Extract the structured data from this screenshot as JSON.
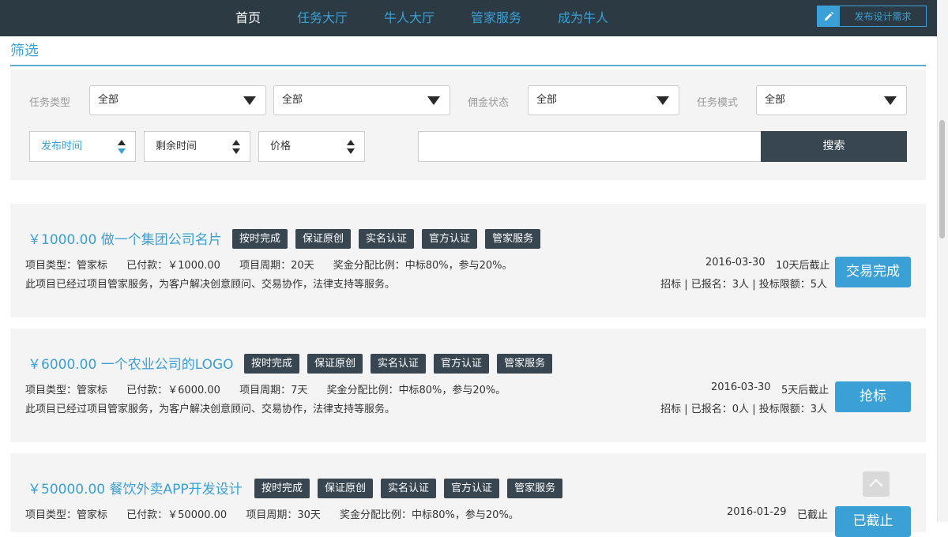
{
  "nav": {
    "items": [
      {
        "label": "首页",
        "active": true
      },
      {
        "label": "任务大厅",
        "active": false
      },
      {
        "label": "牛人大厅",
        "active": false
      },
      {
        "label": "管家服务",
        "active": false
      },
      {
        "label": "成为牛人",
        "active": false
      }
    ],
    "publish_label": "发布设计需求",
    "publish_icon": "pencil-icon"
  },
  "filter": {
    "title": "筛选",
    "task_type_label": "任务类型",
    "task_type_value": "全部",
    "task_subtype_value": "全部",
    "commission_label": "佣金状态",
    "commission_value": "全部",
    "mode_label": "任务模式",
    "mode_value": "全部",
    "sort_publish": "发布时间",
    "sort_remaining": "剩余时间",
    "sort_price": "价格",
    "search_value": "",
    "search_button": "搜索"
  },
  "tasks": [
    {
      "price_title": "￥1000.00 做一个集团公司名片",
      "tags": [
        "按时完成",
        "保证原创",
        "实名认证",
        "官方认证",
        "管家服务"
      ],
      "type": "项目类型：管家标",
      "paid": "已付款：￥1000.00",
      "period": "项目周期：20天",
      "ratio": "奖金分配比例：中标80%，参与20%。",
      "desc": "此项目已经过项目管家服务，为客户解决创意顾问、交易协作，法律支持等服务。",
      "date": "2016-03-30",
      "deadline": "10天后截止",
      "stats": "招标 | 已报名：3人 | 投标限额：5人",
      "action": "交易完成"
    },
    {
      "price_title": "￥6000.00 一个农业公司的LOGO",
      "tags": [
        "按时完成",
        "保证原创",
        "实名认证",
        "官方认证",
        "管家服务"
      ],
      "type": "项目类型：管家标",
      "paid": "已付款：￥6000.00",
      "period": "项目周期：7天",
      "ratio": "奖金分配比例：中标80%，参与20%。",
      "desc": "此项目已经过项目管家服务，为客户解决创意顾问、交易协作，法律支持等服务。",
      "date": "2016-03-30",
      "deadline": "5天后截止",
      "stats": "招标 | 已报名：0人 | 投标限额：3人",
      "action": "抢标"
    },
    {
      "price_title": "￥50000.00 餐饮外卖APP开发设计",
      "tags": [
        "按时完成",
        "保证原创",
        "实名认证",
        "官方认证",
        "管家服务"
      ],
      "type": "项目类型：管家标",
      "paid": "已付款：￥50000.00",
      "period": "项目周期：30天",
      "ratio": "奖金分配比例：中标80%，参与20%。",
      "date": "2016-01-29",
      "deadline": "已截止",
      "action": "已截止"
    }
  ],
  "back_to_top_icon": "chevron-up-icon"
}
